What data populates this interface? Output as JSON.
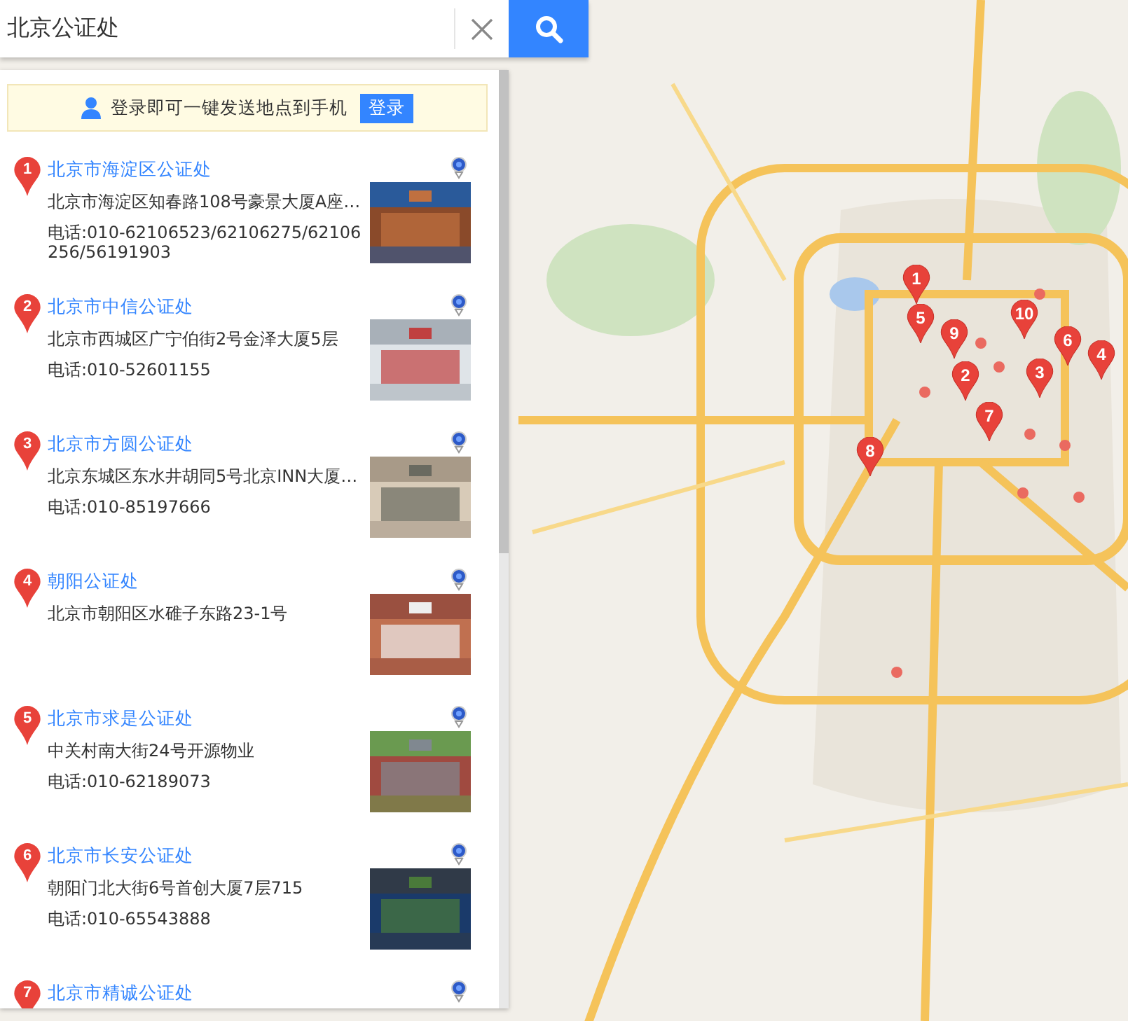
{
  "search": {
    "value": "北京公证处"
  },
  "login_tip": {
    "text": "登录即可一键发送地点到手机",
    "button": "登录"
  },
  "results": [
    {
      "number": "1",
      "name": "北京市海淀区公证处",
      "address": "北京市海淀区知春路108号豪景大厦A座…",
      "phone": "电话:010-62106523/62106275/62106256/56191903",
      "photo": true
    },
    {
      "number": "2",
      "name": "北京市中信公证处",
      "address": "北京市西城区广宁伯街2号金泽大厦5层",
      "phone": "电话:010-52601155",
      "photo": true
    },
    {
      "number": "3",
      "name": "北京市方圆公证处",
      "address": "北京东城区东水井胡同5号北京INN大厦…",
      "phone": "电话:010-85197666",
      "photo": true
    },
    {
      "number": "4",
      "name": "朝阳公证处",
      "address": "北京市朝阳区水碓子东路23-1号",
      "photo": true
    },
    {
      "number": "5",
      "name": "北京市求是公证处",
      "address": "中关村南大街24号开源物业",
      "phone": "电话:010-62189073",
      "photo": true
    },
    {
      "number": "6",
      "name": "北京市长安公证处",
      "address": "朝阳门北大街6号首创大厦7层715",
      "phone": "电话:010-65543888",
      "photo": true
    },
    {
      "number": "7",
      "name": "北京市精诚公证处"
    }
  ],
  "map": {
    "kind": "picture",
    "markers": [
      {
        "label": "1"
      },
      {
        "label": "2"
      },
      {
        "label": "3"
      },
      {
        "label": "4"
      },
      {
        "label": "5"
      },
      {
        "label": "6"
      },
      {
        "label": "7"
      },
      {
        "label": "8"
      },
      {
        "label": "9"
      },
      {
        "label": "10"
      }
    ]
  }
}
